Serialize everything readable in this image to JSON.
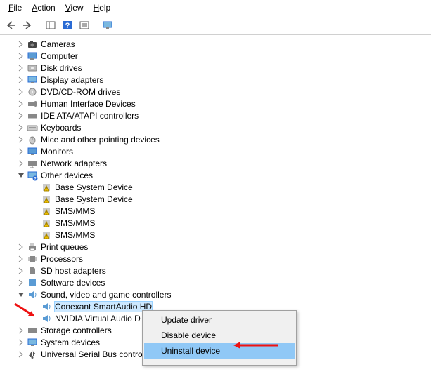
{
  "menu": {
    "file": "File",
    "action": "Action",
    "view": "View",
    "help": "Help"
  },
  "tree": {
    "cameras": "Cameras",
    "computer": "Computer",
    "disk_drives": "Disk drives",
    "display_adapters": "Display adapters",
    "dvd": "DVD/CD-ROM drives",
    "hid": "Human Interface Devices",
    "ide": "IDE ATA/ATAPI controllers",
    "keyboards": "Keyboards",
    "mice": "Mice and other pointing devices",
    "monitors": "Monitors",
    "network": "Network adapters",
    "other_devices": "Other devices",
    "base_system_device": "Base System Device",
    "sms_mms": "SMS/MMS",
    "print_queues": "Print queues",
    "processors": "Processors",
    "sd_host": "SD host adapters",
    "software_devices": "Software devices",
    "sound": "Sound, video and game controllers",
    "conexant": "Conexant SmartAudio HD",
    "nvidia_audio": "NVIDIA Virtual Audio D",
    "storage_controllers": "Storage controllers",
    "system_devices": "System devices",
    "usb_controllers": "Universal Serial Bus contro"
  },
  "context_menu": {
    "update_driver": "Update driver",
    "disable_device": "Disable device",
    "uninstall_device": "Uninstall device"
  }
}
